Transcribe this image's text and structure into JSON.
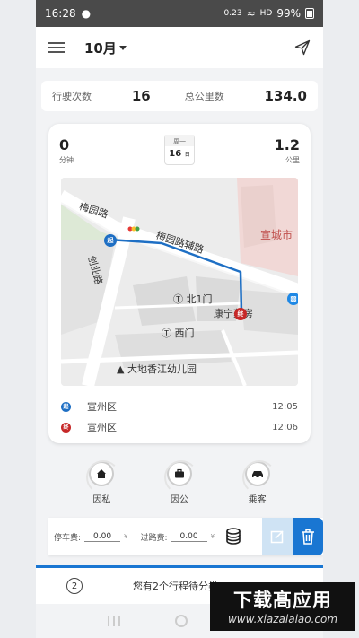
{
  "status_bar": {
    "time": "16:28",
    "speed_top": "0.23",
    "speed_bottom": "K/s",
    "network": "HD",
    "battery": "99%"
  },
  "header": {
    "month": "10月"
  },
  "stats": {
    "trips_label": "行驶次数",
    "trips_value": "16",
    "distance_label": "总公里数",
    "distance_value": "134.0"
  },
  "trip": {
    "duration_value": "0",
    "duration_unit": "分钟",
    "weekday": "周一",
    "day": "16",
    "day_unit": "日",
    "distance_value": "1.2",
    "distance_unit": "公里",
    "start_badge": "起",
    "end_badge": "终",
    "start_place": "宣州区",
    "start_time": "12:05",
    "end_place": "宣州区",
    "end_time": "12:06",
    "route_color": "#1e6fc4"
  },
  "map": {
    "labels": {
      "road1": "梅园路",
      "road2": "梅园路辅路",
      "road3": "创业路",
      "city": "宣城市",
      "gate_north": "北1门",
      "gate_west": "西门",
      "pharmacy": "康宁药房",
      "kindergarten": "大地香江幼儿园"
    }
  },
  "categories": [
    {
      "label": "因私",
      "icon": "home-icon"
    },
    {
      "label": "因公",
      "icon": "briefcase-icon"
    },
    {
      "label": "乘客",
      "icon": "car-icon"
    }
  ],
  "fees": {
    "parking_label": "停车费:",
    "parking_value": "0.00",
    "toll_label": "过路费:",
    "toll_value": "0.00",
    "currency": "¥"
  },
  "pending": {
    "count": "2",
    "message": "您有2个行程待分类"
  },
  "watermark": {
    "title": "下载高应用",
    "url": "www.xiazaiaiao.com"
  },
  "colors": {
    "accent": "#1976d2",
    "start_pin": "#1e6fc4",
    "end_pin": "#c62828"
  }
}
